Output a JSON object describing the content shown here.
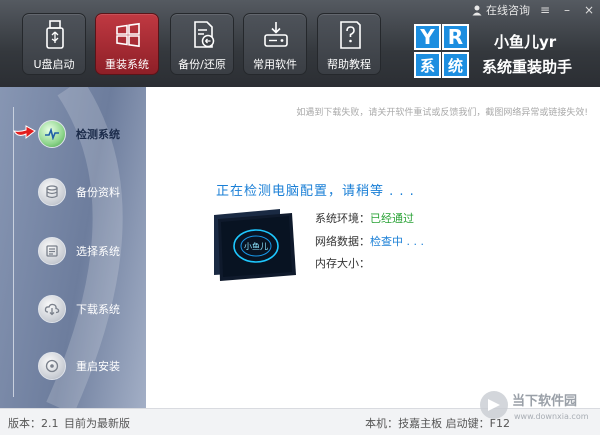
{
  "topbar": {
    "consult": "在线咨询",
    "menu_glyph": "≡",
    "minimize_glyph": "–",
    "close_glyph": "×"
  },
  "nav": [
    {
      "label": "U盘启动"
    },
    {
      "label": "重装系统"
    },
    {
      "label": "备份/还原"
    },
    {
      "label": "常用软件"
    },
    {
      "label": "帮助教程"
    }
  ],
  "brand": {
    "logo_letters": [
      "Y",
      "R",
      "系",
      "统"
    ],
    "name": "小鱼儿yr",
    "subtitle": "系统重装助手"
  },
  "steps": [
    {
      "label": "检测系统",
      "icon": "pulse-icon"
    },
    {
      "label": "备份资料",
      "icon": "database-icon"
    },
    {
      "label": "选择系统",
      "icon": "list-icon"
    },
    {
      "label": "下载系统",
      "icon": "cloud-download-icon"
    },
    {
      "label": "重启安装",
      "icon": "disc-icon"
    }
  ],
  "main": {
    "notice": "如遇到下载失败，请关开软件重试或反馈我们，截图网络异常或链接失效!",
    "title": "正在检测电脑配置，请稍等 . . .",
    "device_logo": "小鱼儿",
    "rows": [
      {
        "label": "系统环境：",
        "value": "已经通过",
        "status": "ok"
      },
      {
        "label": "网络数据：",
        "value": "检查中 . . .",
        "status": "pending"
      },
      {
        "label": "内存大小：",
        "value": "",
        "status": "pending"
      }
    ]
  },
  "footer": {
    "version": "版本：2.1",
    "update": "目前为最新版",
    "hardware": "本机：技嘉主板  启动键：F12"
  },
  "watermark": {
    "site": "当下软件园",
    "url": "www.downxia.com"
  },
  "colors": {
    "accent": "#1a7fd6",
    "active_nav": "#c03942",
    "ok": "#2aa336"
  }
}
